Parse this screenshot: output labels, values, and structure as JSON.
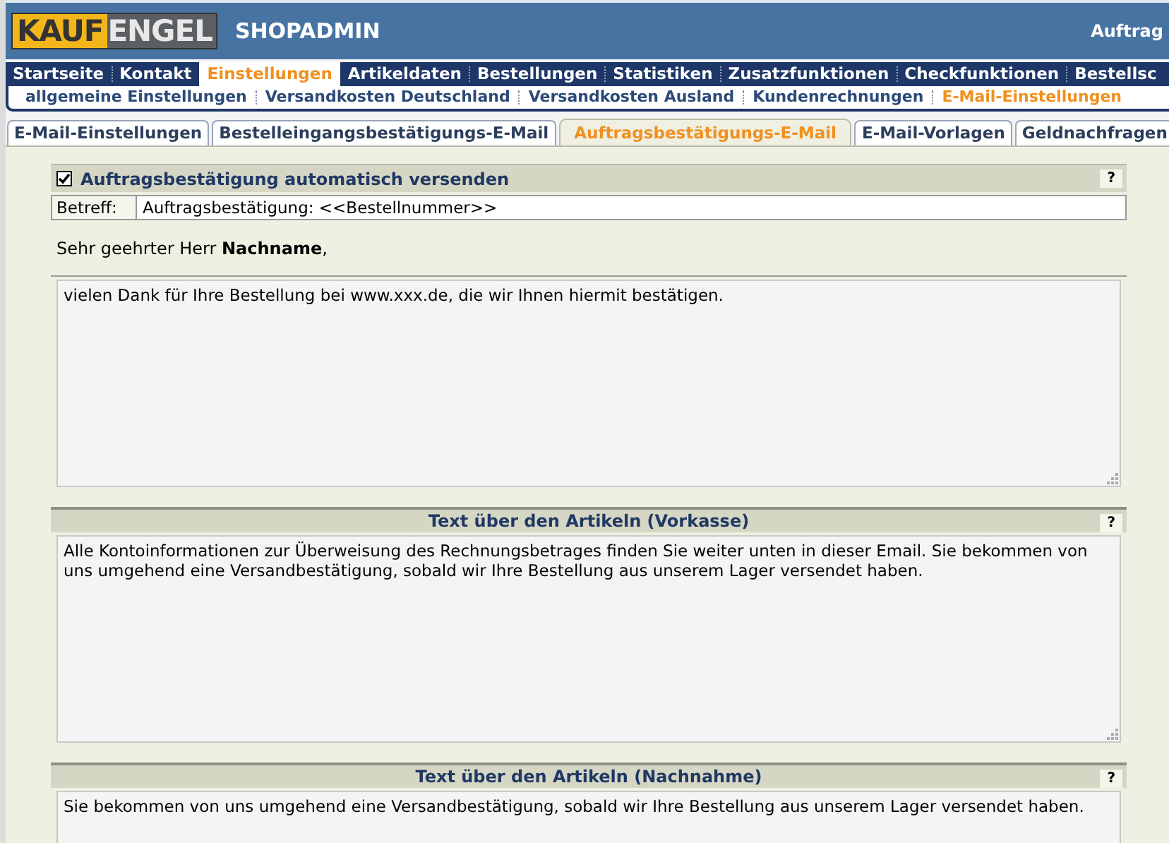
{
  "header": {
    "logo_part_1": "KAUF",
    "logo_part_2": "ENGEL",
    "app_title": "SHOPADMIN",
    "right_text": "Auftrag"
  },
  "nav": [
    {
      "label": "Startseite",
      "selected": false
    },
    {
      "label": "Kontakt",
      "selected": false
    },
    {
      "label": "Einstellungen",
      "selected": true
    },
    {
      "label": "Artikeldaten",
      "selected": false
    },
    {
      "label": "Bestellungen",
      "selected": false
    },
    {
      "label": "Statistiken",
      "selected": false
    },
    {
      "label": "Zusatzfunktionen",
      "selected": false
    },
    {
      "label": "Checkfunktionen",
      "selected": false
    },
    {
      "label": "Bestellsc",
      "selected": false
    }
  ],
  "subnav": [
    {
      "label": "allgemeine Einstellungen",
      "selected": false
    },
    {
      "label": "Versandkosten Deutschland",
      "selected": false
    },
    {
      "label": "Versandkosten Ausland",
      "selected": false
    },
    {
      "label": "Kundenrechnungen",
      "selected": false
    },
    {
      "label": "E-Mail-Einstellungen",
      "selected": true
    }
  ],
  "tabs": [
    {
      "label": "E-Mail-Einstellungen",
      "selected": false
    },
    {
      "label": "Bestelleingangsbestätigungs-E-Mail",
      "selected": false
    },
    {
      "label": "Auftragsbestätigungs-E-Mail",
      "selected": true
    },
    {
      "label": "E-Mail-Vorlagen",
      "selected": false
    },
    {
      "label": "Geldnachfragen",
      "selected": false
    }
  ],
  "auto_send": {
    "label": "Auftragsbestätigung automatisch versenden",
    "checked": true,
    "help": "?"
  },
  "subject": {
    "label": "Betreff:",
    "value": "Auftragsbestätigung: <<Bestellnummer>>"
  },
  "greeting": "Sehr geehrter Herr **Nachname**,",
  "intro_text": "vielen Dank für Ihre Bestellung bei www.xxx.de, die wir Ihnen hiermit bestätigen.",
  "sections": [
    {
      "title": "Text über den Artikeln (Vorkasse)",
      "help": "?",
      "text": "Alle Kontoinformationen zur Überweisung des Rechnungsbetrages finden Sie weiter unten in dieser Email. Sie bekommen von uns umgehend eine Versandbestätigung, sobald wir Ihre Bestellung aus unserem Lager versendet haben."
    },
    {
      "title": "Text über den Artikeln (Nachnahme)",
      "help": "?",
      "text": "Sie bekommen von uns umgehend eine Versandbestätigung, sobald wir Ihre Bestellung aus unserem Lager versendet haben."
    }
  ]
}
